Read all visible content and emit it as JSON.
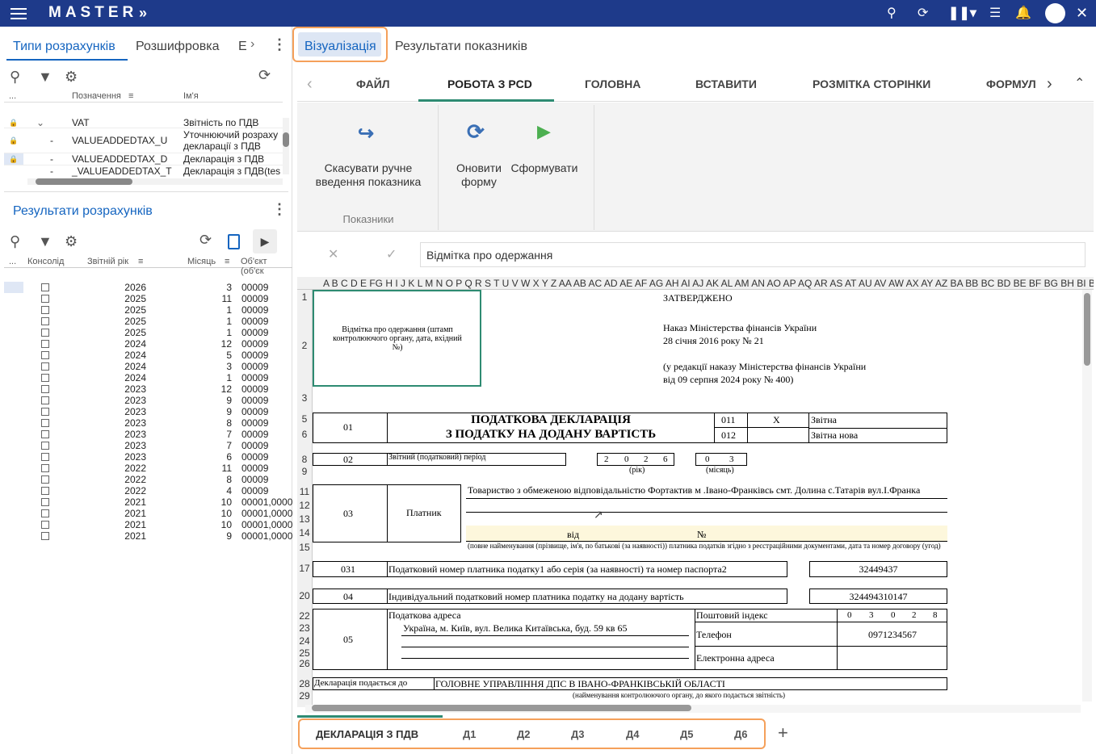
{
  "app": {
    "logo": "MASTER",
    "chevron": "»"
  },
  "left": {
    "tabs": [
      "Типи розрахунків",
      "Розшифровка",
      "Е"
    ],
    "grid1": {
      "headers": [
        "...",
        "Позначення",
        "Ім'я"
      ],
      "rows": [
        {
          "code": "VAT",
          "name": "Звітність по ПДВ"
        },
        {
          "code": "VALUEADDEDTAX_U",
          "name": "Уточнюючий розраху"
        },
        {
          "code": "",
          "name": "декларації з ПДВ"
        },
        {
          "code": "VALUEADDEDTAX_D",
          "name": "Декларація з ПДВ"
        },
        {
          "code": "_VALUEADDEDTAX_T",
          "name": "Декларація з ПДВ(tes"
        }
      ]
    },
    "results_title": "Результати розрахунків",
    "grid2": {
      "headers": [
        "...",
        "Консолід",
        "Звітній рік",
        "Місяць",
        "Об'єкт (об'єк"
      ],
      "rows": [
        [
          "2026",
          "3",
          "00009"
        ],
        [
          "2025",
          "11",
          "00009"
        ],
        [
          "2025",
          "1",
          "00009"
        ],
        [
          "2025",
          "1",
          "00009"
        ],
        [
          "2025",
          "1",
          "00009"
        ],
        [
          "2024",
          "12",
          "00009"
        ],
        [
          "2024",
          "5",
          "00009"
        ],
        [
          "2024",
          "3",
          "00009"
        ],
        [
          "2024",
          "1",
          "00009"
        ],
        [
          "2023",
          "12",
          "00009"
        ],
        [
          "2023",
          "9",
          "00009"
        ],
        [
          "2023",
          "9",
          "00009"
        ],
        [
          "2023",
          "8",
          "00009"
        ],
        [
          "2023",
          "7",
          "00009"
        ],
        [
          "2023",
          "7",
          "00009"
        ],
        [
          "2023",
          "6",
          "00009"
        ],
        [
          "2022",
          "11",
          "00009"
        ],
        [
          "2022",
          "8",
          "00009"
        ],
        [
          "2022",
          "4",
          "00009"
        ],
        [
          "2021",
          "10",
          "00001,0000"
        ],
        [
          "2021",
          "10",
          "00001,0000"
        ],
        [
          "2021",
          "10",
          "00001,0000"
        ],
        [
          "2021",
          "9",
          "00001,0000"
        ]
      ]
    }
  },
  "right": {
    "top_tabs": [
      "Візуалізація",
      "Результати показників"
    ],
    "ribbon_tabs": [
      "ФАЙЛ",
      "РОБОТА З PCD",
      "ГОЛОВНА",
      "ВСТАВИТИ",
      "РОЗМІТКА СТОРІНКИ",
      "ФОРМУЛ"
    ],
    "ribbon": {
      "cancel": "Скасувати ручне введення показника",
      "group": "Показники",
      "refresh": "Оновити форму",
      "generate": "Сформувати"
    },
    "formula_value": "Відмітка про одержання",
    "col_headers": "A   B   C   D  E   FG H I  J K L M N O P Q R S T U V W X Y Z AA AB AC AD AE AF AG AH AI AJ AK AL AM AN AO AP AQ AR AS AT AU AV AW AX AY AZ BA BB BC BD BE BF   BG      BH      BI     BJ BK BL BM BN BO BP BQ BR BS BT BU BV BW BX BY BZ CA CB CC CD CE CF CG CH CI CJ CK",
    "sheet_tabs": [
      "ДЕКЛАРАЦІЯ З ПДВ",
      "Д1",
      "Д2",
      "Д3",
      "Д4",
      "Д5",
      "Д6"
    ]
  },
  "doc": {
    "stamp": "Відмітка про одержання (штамп контролюючого органу, дата, вхідний №)",
    "approved": "ЗАТВЕРДЖЕНО",
    "order1": "Наказ Міністерства фінансів України",
    "order2": "28 січня 2016 року № 21",
    "order3": "(у редакції наказу Міністерства фінансів України",
    "order4": "від 09 серпня 2024 року № 400)",
    "title1": "ПОДАТКОВА ДЕКЛАРАЦІЯ",
    "title2": "З ПОДАТКУ НА ДОДАНУ ВАРТІСТЬ",
    "c01": "01",
    "c011": "011",
    "c012": "012",
    "x": "X",
    "zv": "Звітна",
    "zvn": "Звітна нова",
    "c02": "02",
    "period": "Звітний (податковий) період",
    "year_digits": [
      "2",
      "0",
      "2",
      "6"
    ],
    "month_digits": [
      "0",
      "3"
    ],
    "rik": "(рік)",
    "mis": "(місяць)",
    "c03": "03",
    "payer": "Платник",
    "payer_name": "Товариство з обмеженою відповідальністю Фортактив м .Івано-Франківсь смт. Долина с.Татарів вул.І.Франка",
    "vid": "від",
    "no": "№",
    "payer_note": "(повне найменування (прізвище, ім'я, по батькові (за наявності)) платника податків згідно з реєстраційними документами, дата та номер договору (угод)",
    "c031": "031",
    "taxno_lbl": "Податковий номер платника податку1 або серія (за наявності) та номер паспорта2",
    "taxno": "32449437",
    "c04": "04",
    "ipn_lbl": "Індивідуальний податковий номер платника податку на додану вартість",
    "ipn": "324494310147",
    "c05": "05",
    "addr_lbl": "Податкова адреса",
    "addr": "Україна, м. Київ, вул. Велика Китаївська, буд. 59  кв 65",
    "postal": "Поштовий індекс",
    "postal_digits": [
      "0",
      "3",
      "0",
      "2",
      "8"
    ],
    "phone_lbl": "Телефон",
    "phone": "0971234567",
    "email_lbl": "Електронна адреса",
    "submit_lbl": "Декларація подається до",
    "submit_to": "ГОЛОВНЕ УПРАВЛІННЯ ДПС В ІВАНО-ФРАНКІВСЬКІЙ ОБЛАСТІ",
    "submit_note": "(найменування контролюючого органу, до якого подається звітність)"
  },
  "colors": {
    "brand": "#1e3a8a",
    "accent": "#1565c0",
    "highlight": "#f5a05a"
  }
}
